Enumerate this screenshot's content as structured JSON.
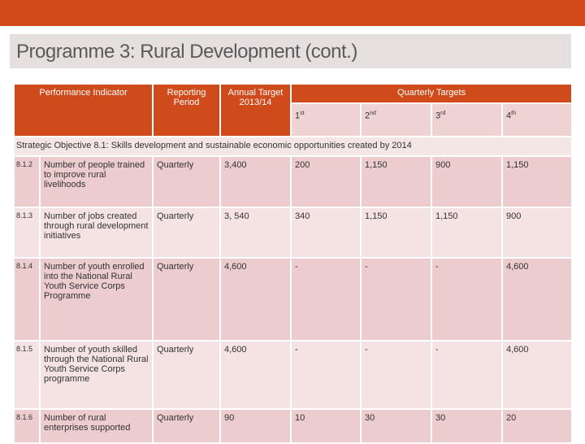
{
  "title": "Programme 3: Rural Development  (cont.)",
  "header": {
    "indicator": "Performance Indicator",
    "period": "Reporting Period",
    "annual": "Annual Target 2013/14",
    "quarterly": "Quarterly Targets",
    "quarters": [
      {
        "n": "1",
        "s": "st"
      },
      {
        "n": "2",
        "s": "nd"
      },
      {
        "n": "3",
        "s": "rd"
      },
      {
        "n": "4",
        "s": "th"
      }
    ]
  },
  "objective": "Strategic Objective 8.1:  Skills development and sustainable economic opportunities created by 2014",
  "rows": [
    {
      "id": "8.1.2",
      "indicator": "Number of people trained to improve rural livelihoods",
      "period": "Quarterly",
      "annual": "3,400",
      "q": [
        "200",
        "1,150",
        "900",
        "1,150"
      ]
    },
    {
      "id": "8.1.3",
      "indicator": "Number of jobs created through rural development initiatives",
      "period": "Quarterly",
      "annual": "3, 540",
      "q": [
        "340",
        "1,150",
        "1,150",
        "900"
      ]
    },
    {
      "id": "8.1.4",
      "indicator": "Number of youth enrolled into the National Rural Youth Service Corps Programme",
      "period": "Quarterly",
      "annual": "4,600",
      "q": [
        "-",
        "-",
        "-",
        "4,600"
      ]
    },
    {
      "id": "8.1.5",
      "indicator": "Number of youth skilled through the National Rural Youth Service Corps programme",
      "period": "Quarterly",
      "annual": "4,600",
      "q": [
        "-",
        "-",
        "-",
        "4,600"
      ]
    },
    {
      "id": "8.1.6",
      "indicator": "Number of rural enterprises supported",
      "period": "Quarterly",
      "annual": "90",
      "q": [
        "10",
        "30",
        "30",
        "20"
      ]
    }
  ]
}
